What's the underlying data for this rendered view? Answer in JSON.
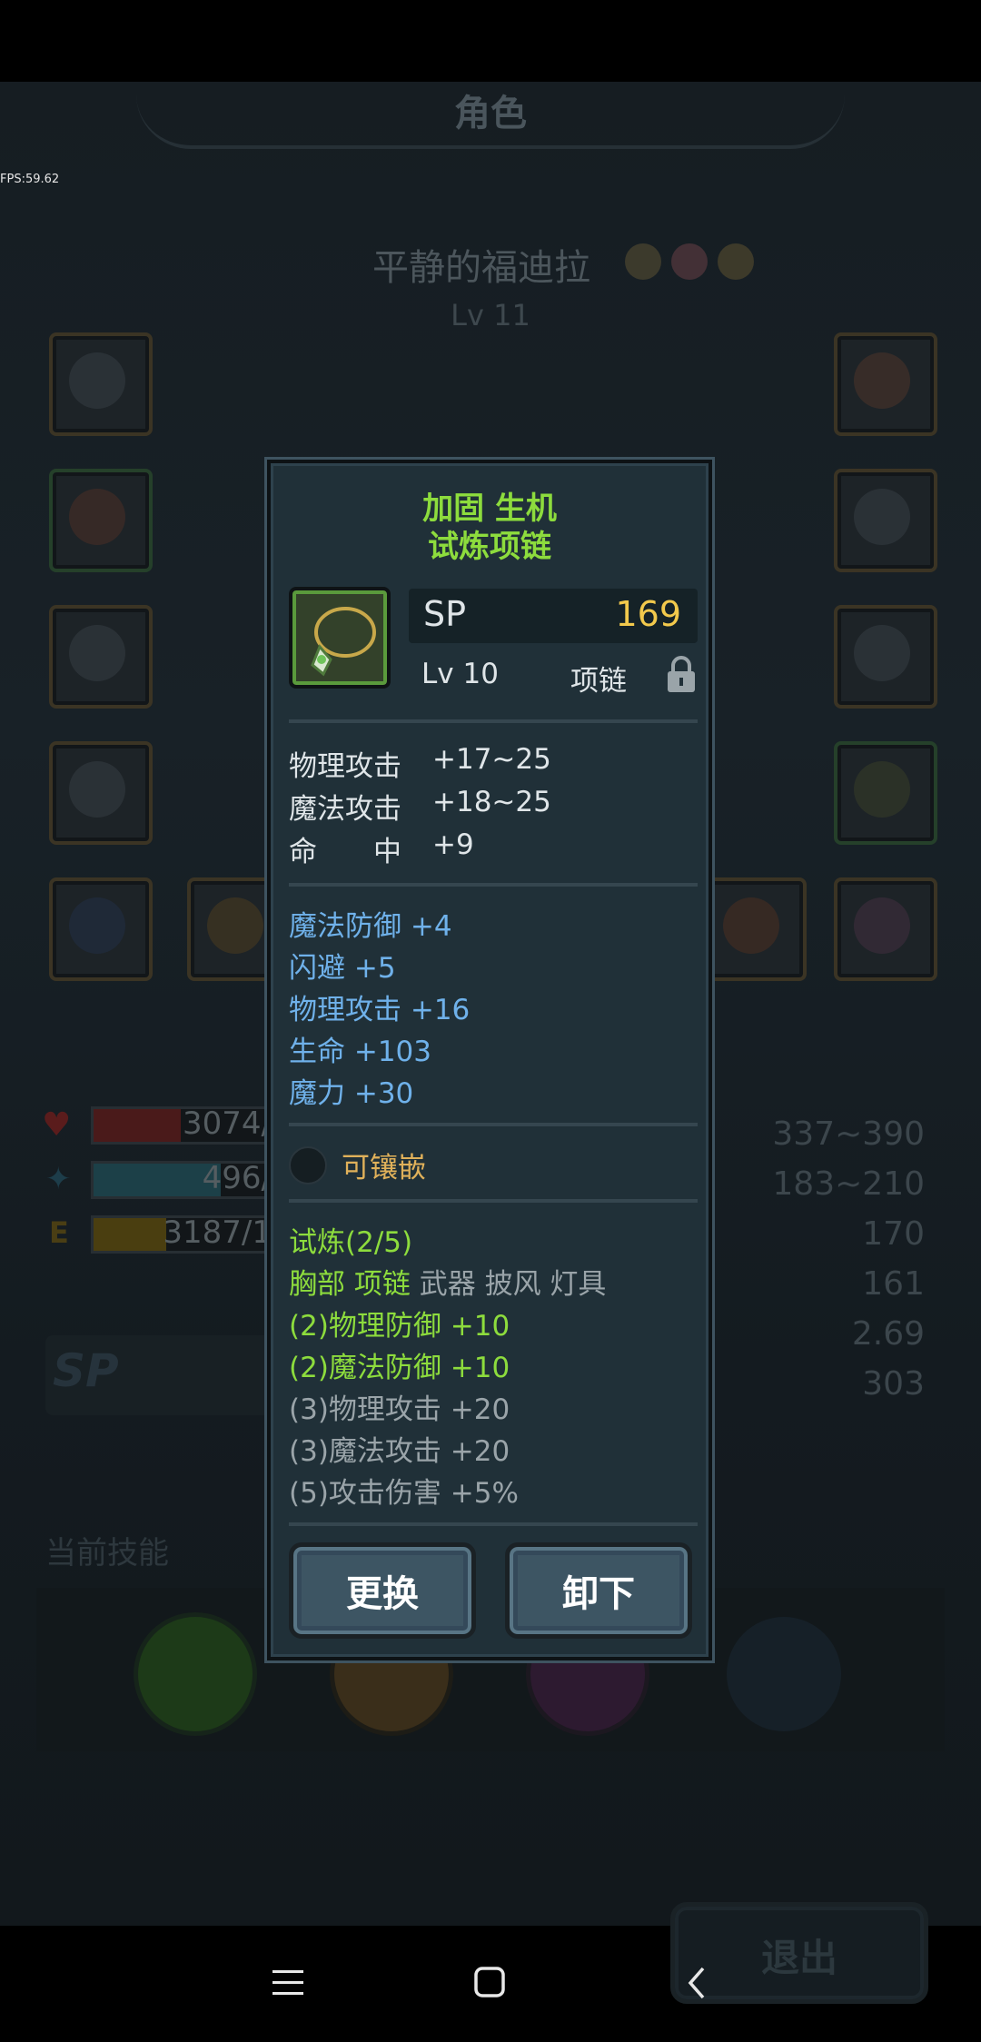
{
  "fps": "FPS:59.62",
  "screen_title": "角色",
  "character": {
    "name": "平静的福迪拉",
    "level": "Lv 11"
  },
  "bars": {
    "hp": "3074/",
    "mp": "496/",
    "exp": "3187/1"
  },
  "right_stats": [
    "337~390",
    "183~210",
    "170",
    "161",
    "2.69",
    "303"
  ],
  "sp_label": "SP",
  "skills_label": "当前技能",
  "exit_label": "退出",
  "item": {
    "title_line1": "加固 生机",
    "title_line2": "试炼项链",
    "sp_label": "SP",
    "sp_value": "169",
    "level": "Lv 10",
    "type": "项链",
    "base_stats": [
      {
        "name": "物理攻击",
        "value": "+17~25"
      },
      {
        "name": "魔法攻击",
        "value": "+18~25"
      },
      {
        "name": "命　　中",
        "value": "+9"
      }
    ],
    "extra_stats": [
      "魔法防御 +4",
      "闪避 +5",
      "物理攻击 +16",
      "生命 +103",
      "魔力 +30"
    ],
    "socket_label": "可镶嵌",
    "set_name": "试炼(2/5)",
    "set_parts_owned": "胸部 项链",
    "set_parts_missing": "武器 披风 灯具",
    "set_bonuses_active": [
      "(2)物理防御 +10",
      "(2)魔法防御 +10"
    ],
    "set_bonuses_inactive": [
      "(3)物理攻击 +20",
      "(3)魔法攻击 +20",
      "(5)攻击伤害 +5%"
    ],
    "replace_button": "更换",
    "unequip_button": "卸下"
  },
  "colors": {
    "set_green": "#8ddc3d",
    "stat_blue": "#6fb1ea",
    "sp_gold": "#f2c94c",
    "socket_gold": "#e0b15a"
  }
}
